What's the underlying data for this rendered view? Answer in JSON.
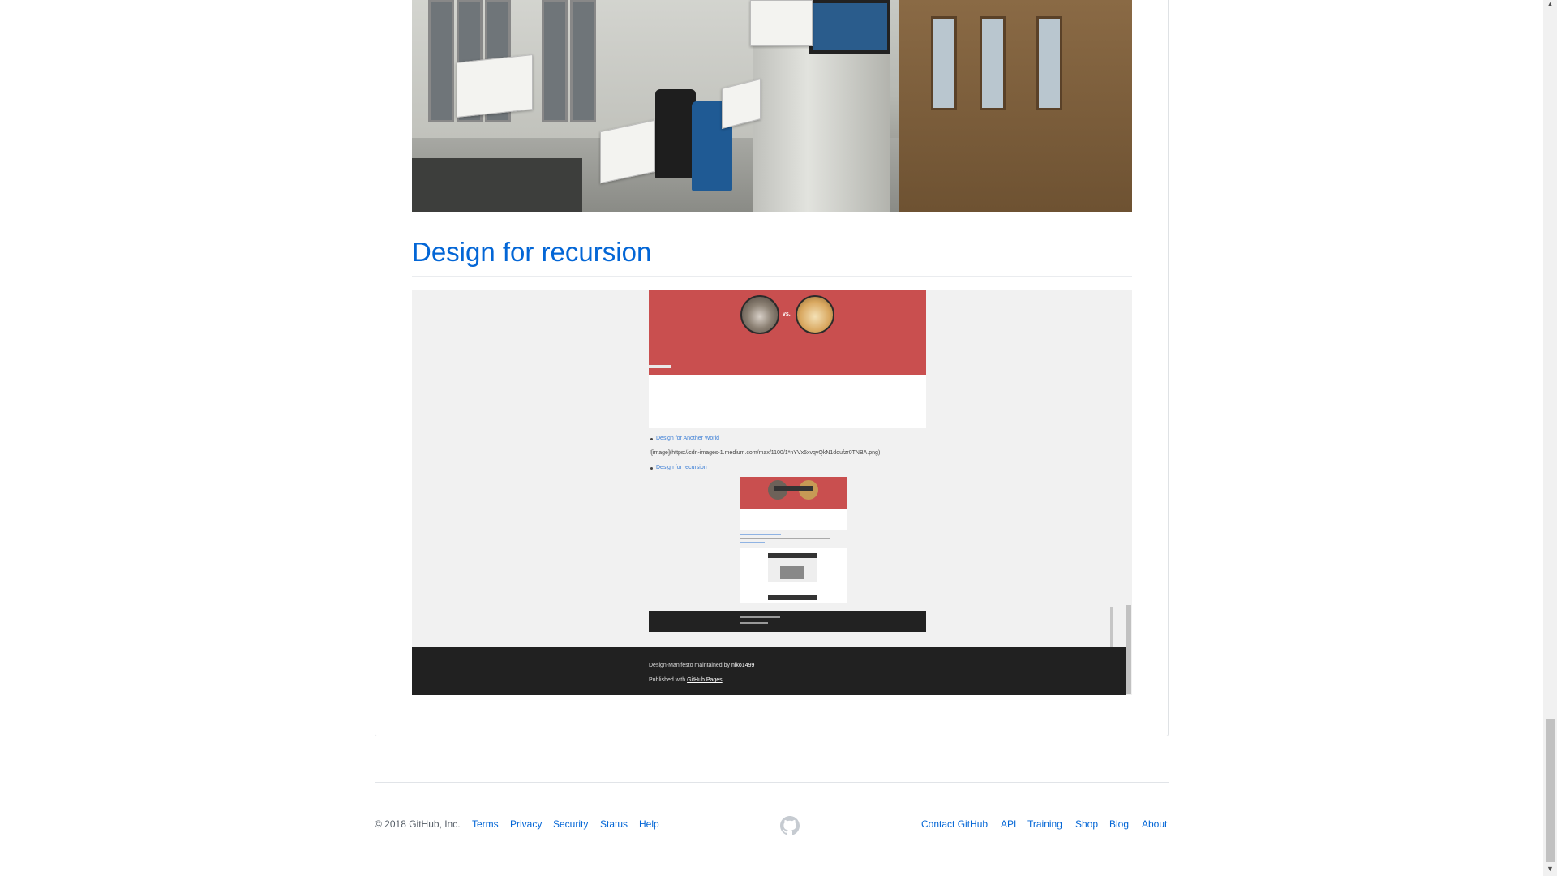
{
  "readme": {
    "section_heading": "Design for recursion",
    "embedded_page": {
      "vs_label": "vs.",
      "list": [
        {
          "label": "Design for Another World"
        },
        {
          "label": "Design for recursion"
        }
      ],
      "markdown_text": "![image](https://cdn-images-1.medium.com/max/1100/1*nYVx5xvqvQkN1doufzr0TNBA.png)",
      "footer_maintained_prefix": "Design-Manifesto maintained by ",
      "footer_maintained_user": "niko1499",
      "footer_published_prefix": "Published with ",
      "footer_published_link": "GitHub Pages"
    }
  },
  "footer": {
    "copyright": "© 2018 GitHub, Inc.",
    "left_links": [
      "Terms",
      "Privacy",
      "Security",
      "Status",
      "Help"
    ],
    "right_links": [
      "Contact GitHub",
      "API",
      "Training",
      "Shop",
      "Blog",
      "About"
    ],
    "logo_icon": "github-mark-icon"
  },
  "colors": {
    "link": "#0366d6",
    "banner": "#c94f4f",
    "footer_dark": "#212121"
  }
}
